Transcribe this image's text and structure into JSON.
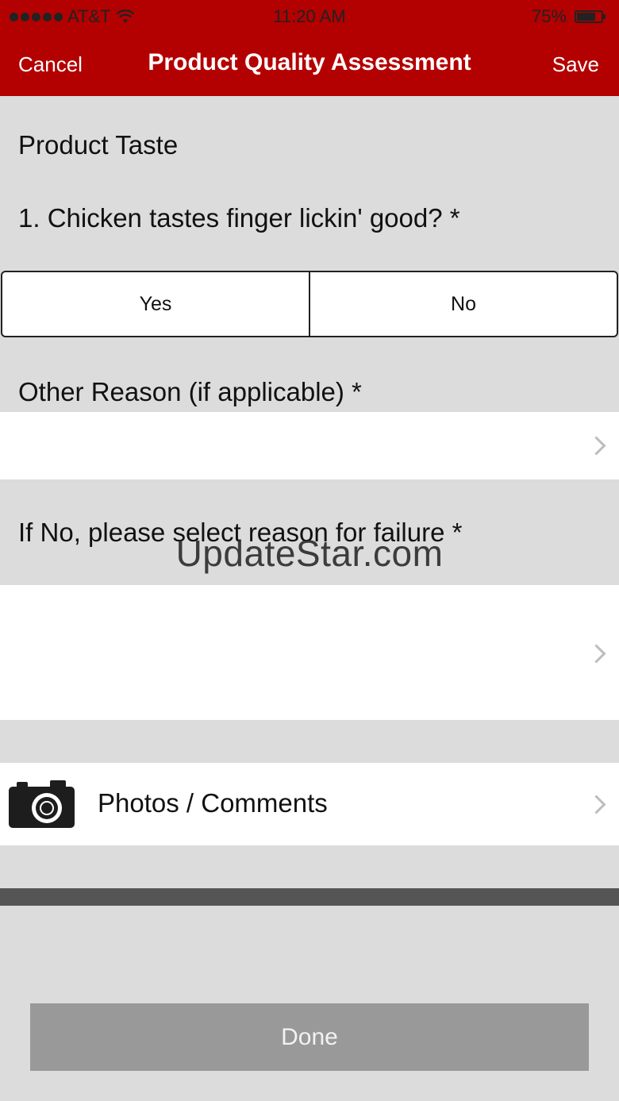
{
  "status_bar": {
    "carrier": "AT&T",
    "time": "11:20 AM",
    "battery": "75%",
    "battery_level": 0.75,
    "signal_icon": "signal-dots-icon",
    "wifi_icon": "wifi-icon"
  },
  "nav": {
    "cancel": "Cancel",
    "title": "Product Quality Assessment",
    "save": "Save"
  },
  "form": {
    "section_title": "Product Taste",
    "question": "1. Chicken tastes finger lickin' good? *",
    "options": [
      "Yes",
      "No"
    ],
    "other_reason_label": "Other Reason (if applicable) *",
    "failure_reason_label": "If No, please select reason for failure *",
    "photos_label": "Photos / Comments",
    "photos_icon": "camera-icon",
    "done": "Done"
  },
  "watermark": "UpdateStar.com",
  "colors": {
    "nav_bg": "#b30000",
    "page_bg": "#dcdcdc",
    "done_bg": "#999999",
    "divider": "#555555"
  }
}
